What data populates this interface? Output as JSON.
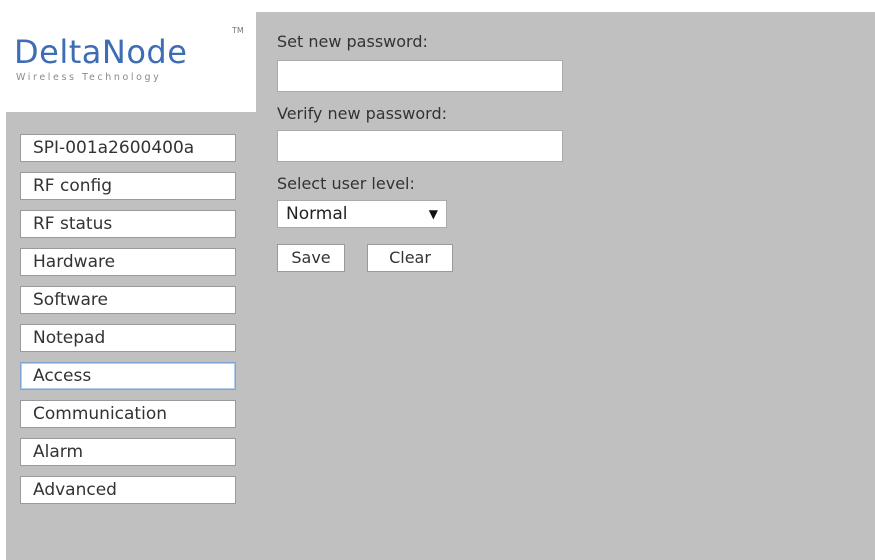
{
  "logo": {
    "main": "DeltaNode",
    "trademark": "TM",
    "sub": "Wireless Technology"
  },
  "nav": {
    "items": [
      {
        "label": "SPI-001a2600400a"
      },
      {
        "label": "RF config"
      },
      {
        "label": "RF status"
      },
      {
        "label": "Hardware"
      },
      {
        "label": "Software"
      },
      {
        "label": "Notepad"
      },
      {
        "label": "Access"
      },
      {
        "label": "Communication"
      },
      {
        "label": "Alarm"
      },
      {
        "label": "Advanced"
      }
    ],
    "active_label": "Access"
  },
  "form": {
    "new_password_label": "Set new password:",
    "new_password_value": "",
    "verify_password_label": "Verify new password:",
    "verify_password_value": "",
    "user_level_label": "Select user level:",
    "user_level_value": "Normal",
    "save_label": "Save",
    "clear_label": "Clear"
  },
  "colors": {
    "background": "#c0c0c0",
    "logo_blue": "#3d6db5",
    "active_border": "#7fa3cf"
  }
}
